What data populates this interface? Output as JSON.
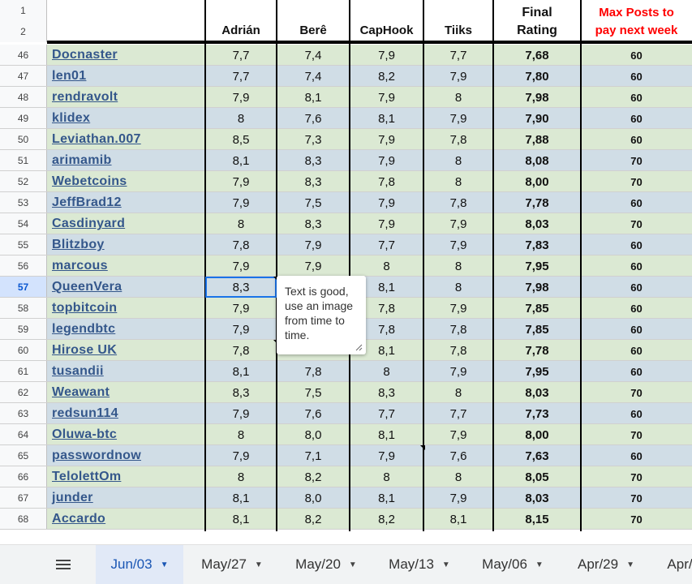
{
  "header": {
    "rownums": [
      "1",
      "2"
    ],
    "columns": [
      {
        "label": "Adrián"
      },
      {
        "label": "Berê"
      },
      {
        "label": "CapHook"
      },
      {
        "label": "Tiiks"
      },
      {
        "label": "Final\nRating"
      },
      {
        "label": "Max Posts to\npay next week"
      }
    ]
  },
  "rows": [
    {
      "n": "46",
      "name": "Docnaster",
      "a": "7,7",
      "b": "7,4",
      "c": "7,9",
      "d": "7,7",
      "f": "7,68",
      "m": "60"
    },
    {
      "n": "47",
      "name": "len01",
      "a": "7,7",
      "b": "7,4",
      "c": "8,2",
      "d": "7,9",
      "f": "7,80",
      "m": "60"
    },
    {
      "n": "48",
      "name": "rendravolt",
      "a": "7,9",
      "b": "8,1",
      "c": "7,9",
      "d": "8",
      "f": "7,98",
      "m": "60"
    },
    {
      "n": "49",
      "name": "klidex",
      "a": "8",
      "b": "7,6",
      "c": "8,1",
      "d": "7,9",
      "f": "7,90",
      "m": "60"
    },
    {
      "n": "50",
      "name": "Leviathan.007",
      "a": "8,5",
      "b": "7,3",
      "c": "7,9",
      "d": "7,8",
      "f": "7,88",
      "m": "60"
    },
    {
      "n": "51",
      "name": "arimamib",
      "a": "8,1",
      "b": "8,3",
      "c": "7,9",
      "d": "8",
      "f": "8,08",
      "m": "70"
    },
    {
      "n": "52",
      "name": "Webetcoins",
      "a": "7,9",
      "b": "8,3",
      "c": "7,8",
      "d": "8",
      "f": "8,00",
      "m": "70"
    },
    {
      "n": "53",
      "name": "JeffBrad12",
      "a": "7,9",
      "b": "7,5",
      "c": "7,9",
      "d": "7,8",
      "f": "7,78",
      "m": "60"
    },
    {
      "n": "54",
      "name": "Casdinyard",
      "a": "8",
      "b": "8,3",
      "c": "7,9",
      "d": "7,9",
      "f": "8,03",
      "m": "70"
    },
    {
      "n": "55",
      "name": "Blitzboy",
      "a": "7,8",
      "b": "7,9",
      "c": "7,7",
      "d": "7,9",
      "f": "7,83",
      "m": "60"
    },
    {
      "n": "56",
      "name": "marcous",
      "a": "7,9",
      "b": "7,9",
      "c": "8",
      "d": "8",
      "f": "7,95",
      "m": "60"
    },
    {
      "n": "57",
      "name": "QueenVera",
      "a": "8,3",
      "b": "",
      "c": "8,1",
      "d": "8",
      "f": "7,98",
      "m": "60"
    },
    {
      "n": "58",
      "name": "topbitcoin",
      "a": "7,9",
      "b": "",
      "c": "7,8",
      "d": "7,9",
      "f": "7,85",
      "m": "60"
    },
    {
      "n": "59",
      "name": "legendbtc",
      "a": "7,9",
      "b": "",
      "c": "7,8",
      "d": "7,8",
      "f": "7,85",
      "m": "60"
    },
    {
      "n": "60",
      "name": "Hirose UK",
      "a": "7,8",
      "b": "",
      "c": "8,1",
      "d": "7,8",
      "f": "7,78",
      "m": "60"
    },
    {
      "n": "61",
      "name": "tusandii",
      "a": "8,1",
      "b": "7,8",
      "c": "8",
      "d": "7,9",
      "f": "7,95",
      "m": "60"
    },
    {
      "n": "62",
      "name": "Weawant",
      "a": "8,3",
      "b": "7,5",
      "c": "8,3",
      "d": "8",
      "f": "8,03",
      "m": "70"
    },
    {
      "n": "63",
      "name": "redsun114",
      "a": "7,9",
      "b": "7,6",
      "c": "7,7",
      "d": "7,7",
      "f": "7,73",
      "m": "60"
    },
    {
      "n": "64",
      "name": "Oluwa-btc",
      "a": "8",
      "b": "8,0",
      "c": "8,1",
      "d": "7,9",
      "f": "8,00",
      "m": "70"
    },
    {
      "n": "65",
      "name": "passwordnow",
      "a": "7,9",
      "b": "7,1",
      "c": "7,9",
      "d": "7,6",
      "f": "7,63",
      "m": "60"
    },
    {
      "n": "66",
      "name": "TelolettOm",
      "a": "8",
      "b": "8,2",
      "c": "8",
      "d": "8",
      "f": "8,05",
      "m": "70"
    },
    {
      "n": "67",
      "name": "junder",
      "a": "8,1",
      "b": "8,0",
      "c": "8,1",
      "d": "7,9",
      "f": "8,03",
      "m": "70"
    },
    {
      "n": "68",
      "name": "Accardo",
      "a": "8,1",
      "b": "8,2",
      "c": "8,2",
      "d": "8,1",
      "f": "8,15",
      "m": "70"
    }
  ],
  "note": {
    "text": "Text is good, use an image from time to time."
  },
  "tabs": [
    {
      "label": "Jun/03",
      "active": true
    },
    {
      "label": "May/27"
    },
    {
      "label": "May/20"
    },
    {
      "label": "May/13"
    },
    {
      "label": "May/06"
    },
    {
      "label": "Apr/29"
    },
    {
      "label": "Apr/"
    }
  ],
  "colors": {
    "green": "#dbe9d3",
    "blue": "#d0dde6",
    "accent": "#1a73e8",
    "red": "#ff0000",
    "link": "#34578b"
  }
}
